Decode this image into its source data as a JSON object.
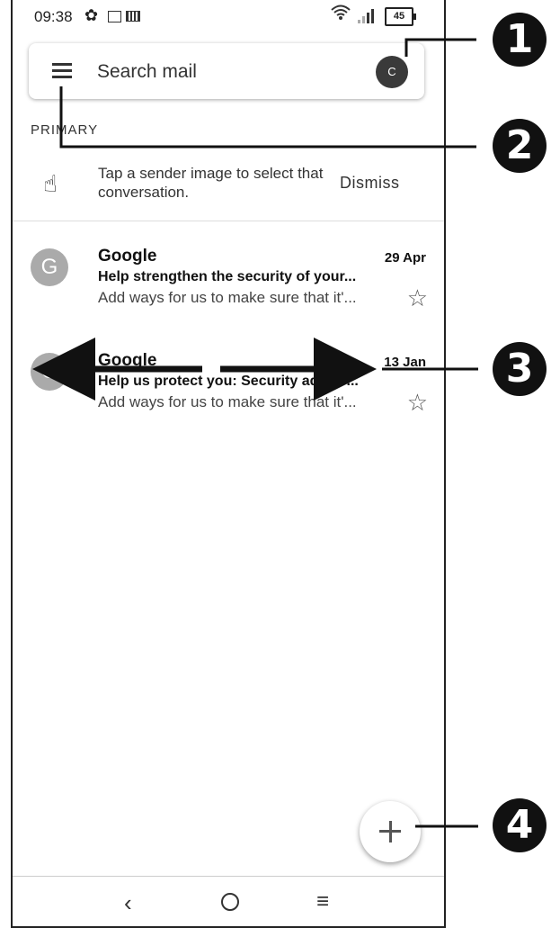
{
  "status_bar": {
    "time": "09:38",
    "battery": "45"
  },
  "search": {
    "placeholder": "Search mail",
    "avatar_letter": "C"
  },
  "section_label": "PRIMARY",
  "tip": {
    "text": "Tap a sender image to select that conversation.",
    "dismiss_label": "Dismiss"
  },
  "emails": [
    {
      "avatar_letter": "G",
      "sender": "Google",
      "date": "29 Apr",
      "subject": "Help strengthen the security of your...",
      "snippet": "Add ways for us to make sure that it'..."
    },
    {
      "avatar_letter": "G",
      "sender": "Google",
      "date": "13 Jan",
      "subject": "Help us protect you: Security advice...",
      "snippet": "Add ways for us to make sure that it'..."
    }
  ],
  "callouts": [
    "1",
    "2",
    "3",
    "4"
  ],
  "colors": {
    "avatar_dark": "#3a3a3a",
    "avatar_grey": "#aaaaaa",
    "callout": "#111111"
  }
}
